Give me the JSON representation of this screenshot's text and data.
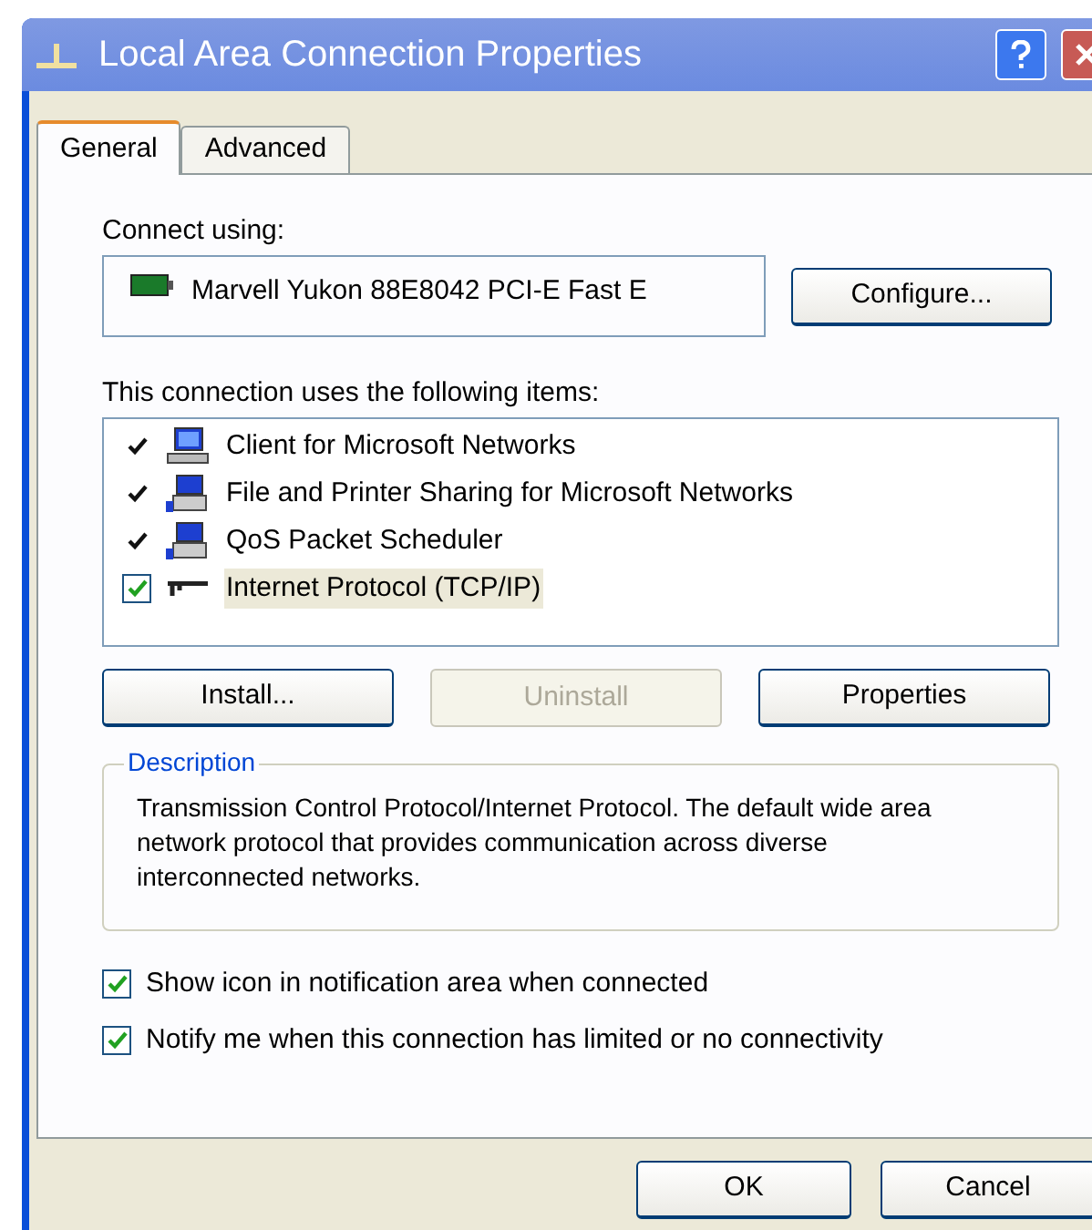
{
  "window": {
    "title": "Local Area Connection Properties"
  },
  "tabs": [
    {
      "label": "General",
      "selected": true
    },
    {
      "label": "Advanced",
      "selected": false
    }
  ],
  "connect_using": {
    "label": "Connect using:",
    "adapter": "Marvell Yukon 88E8042 PCI-E Fast E",
    "button": "Configure..."
  },
  "items_label": "This connection uses the following items:",
  "items": [
    {
      "label": "Client for Microsoft Networks",
      "checked": true,
      "selected": false,
      "kind": "computer"
    },
    {
      "label": "File and Printer Sharing for Microsoft Networks",
      "checked": true,
      "selected": false,
      "kind": "service"
    },
    {
      "label": "QoS Packet Scheduler",
      "checked": true,
      "selected": false,
      "kind": "service"
    },
    {
      "label": "Internet Protocol (TCP/IP)",
      "checked": true,
      "selected": true,
      "kind": "protocol"
    }
  ],
  "item_buttons": [
    {
      "label": "Install...",
      "disabled": false
    },
    {
      "label": "Uninstall",
      "disabled": true
    },
    {
      "label": "Properties",
      "disabled": false
    }
  ],
  "description": {
    "title": "Description",
    "text": "Transmission Control Protocol/Internet Protocol. The default wide area network protocol that provides communication across diverse interconnected networks."
  },
  "options": [
    {
      "label": "Show icon in notification area when connected",
      "checked": true
    },
    {
      "label": "Notify me when this connection has limited or no connectivity",
      "checked": true
    }
  ],
  "buttons": [
    "OK",
    "Cancel"
  ]
}
